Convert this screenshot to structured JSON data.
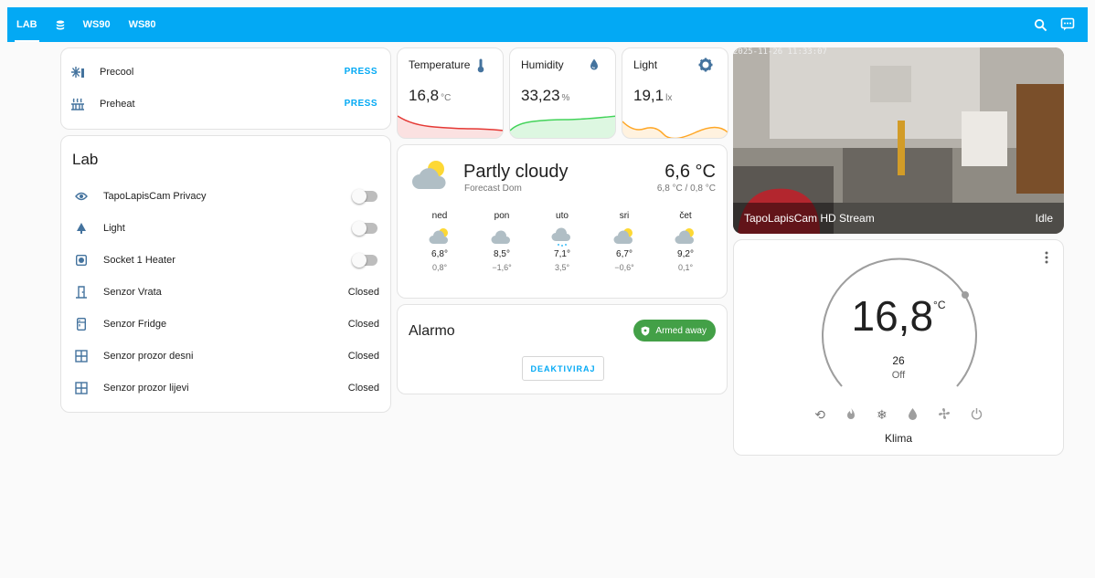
{
  "topbar": {
    "tabs": [
      "LAB",
      "WS90",
      "WS80"
    ]
  },
  "actions": [
    {
      "label": "Precool",
      "button": "PRESS",
      "icon": "snowflake-icon"
    },
    {
      "label": "Preheat",
      "button": "PRESS",
      "icon": "heat-icon"
    }
  ],
  "lab": {
    "title": "Lab",
    "rows": [
      {
        "label": "TapoLapisCam Privacy",
        "state": "off",
        "icon": "eye-icon"
      },
      {
        "label": "Light",
        "state": "off",
        "icon": "lamp-icon"
      },
      {
        "label": "Socket 1 Heater",
        "state": "off",
        "icon": "socket-icon"
      },
      {
        "label": "Senzor Vrata",
        "value": "Closed",
        "icon": "door-icon"
      },
      {
        "label": "Senzor Fridge",
        "value": "Closed",
        "icon": "fridge-icon"
      },
      {
        "label": "Senzor prozor desni",
        "value": "Closed",
        "icon": "window-icon"
      },
      {
        "label": "Senzor prozor lijevi",
        "value": "Closed",
        "icon": "window-icon"
      }
    ]
  },
  "sensors": {
    "temperature": {
      "name": "Temperature",
      "value": "16,8",
      "unit": "°C",
      "color": "#e53935"
    },
    "humidity": {
      "name": "Humidity",
      "value": "33,23",
      "unit": "%",
      "color": "#43d35a"
    },
    "light": {
      "name": "Light",
      "value": "19,1",
      "unit": "lx",
      "color": "#ffa726"
    }
  },
  "weather": {
    "condition": "Partly cloudy",
    "source": "Forecast Dom",
    "temp": "6,6 °C",
    "hilo": "6,8 °C / 0,8 °C",
    "days": [
      {
        "day": "ned",
        "hi": "6,8°",
        "lo": "0,8°"
      },
      {
        "day": "pon",
        "hi": "8,5°",
        "lo": "−1,6°"
      },
      {
        "day": "uto",
        "hi": "7,1°",
        "lo": "3,5°"
      },
      {
        "day": "sri",
        "hi": "6,7°",
        "lo": "−0,6°"
      },
      {
        "day": "čet",
        "hi": "9,2°",
        "lo": "0,1°"
      }
    ]
  },
  "alarm": {
    "title": "Alarmo",
    "status": "Armed away",
    "button": "DEAKTIVIRAJ"
  },
  "camera": {
    "title": "TapoLapisCam HD Stream",
    "state": "Idle",
    "timestamp": "2025-11-26 11:33:07"
  },
  "climate": {
    "current": "16,8",
    "unit": "°C",
    "target": "26",
    "mode": "Off",
    "name": "Klima"
  }
}
